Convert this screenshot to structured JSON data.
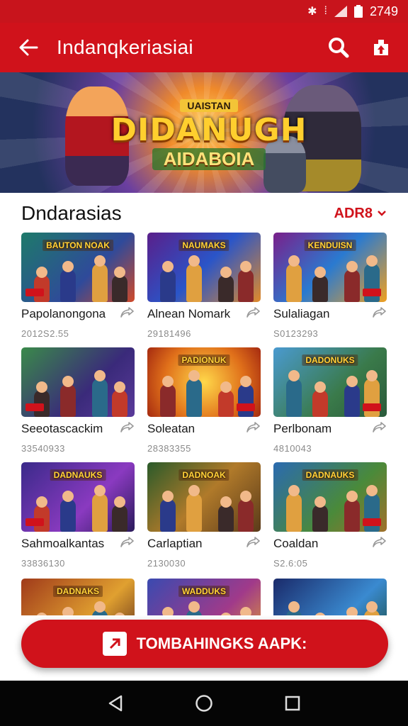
{
  "status_bar": {
    "time": "2749",
    "icons": [
      "bluetooth-icon",
      "vibrate-icon",
      "signal-icon",
      "battery-icon"
    ]
  },
  "toolbar": {
    "title": "Indanqkeriasiai",
    "back_icon": "arrow-left-icon",
    "search_icon": "search-icon",
    "share_icon": "share-icon"
  },
  "banner": {
    "line1": "UAISTAN",
    "line2": "DIDANUGH",
    "line3": "AIDABOIA"
  },
  "section": {
    "title": "Dndarasias",
    "sort_label": "ADR8"
  },
  "games": [
    {
      "name": "Papolanongona",
      "meta": "2012S2.55",
      "thumb_title": "BAUTON NOAK"
    },
    {
      "name": "Alnean Nomark",
      "meta": "29181496",
      "thumb_title": "NAUMAKS"
    },
    {
      "name": "Sulaliagan",
      "meta": "S0123293",
      "thumb_title": "KENDUISN"
    },
    {
      "name": "Seeotascackim",
      "meta": "33540933",
      "thumb_title": ""
    },
    {
      "name": "Soleatan",
      "meta": "28383355",
      "thumb_title": "PADIONUK"
    },
    {
      "name": "Perlbonam",
      "meta": "4810043",
      "thumb_title": "DADONUKS"
    },
    {
      "name": "Sahmoalkantas",
      "meta": "33836130",
      "thumb_title": "DADNAUKS"
    },
    {
      "name": "Carlaptian",
      "meta": "2130030",
      "thumb_title": "DADNOAK"
    },
    {
      "name": "Coaldan",
      "meta": "S2.6:05",
      "thumb_title": "DADNAUKS"
    },
    {
      "name": "",
      "meta": "",
      "thumb_title": "DADNAKS"
    },
    {
      "name": "",
      "meta": "",
      "thumb_title": "WADDUKS"
    },
    {
      "name": "",
      "meta": "",
      "thumb_title": ""
    }
  ],
  "download_button": {
    "label": "TOMBAHINGKS AAPK:",
    "icon": "apk-icon"
  },
  "nav": {
    "back": "nav-back-icon",
    "home": "nav-home-icon",
    "recents": "nav-recents-icon"
  },
  "colors": {
    "primary": "#d0121b",
    "statusbar": "#c8141c",
    "navbar": "#050505"
  }
}
